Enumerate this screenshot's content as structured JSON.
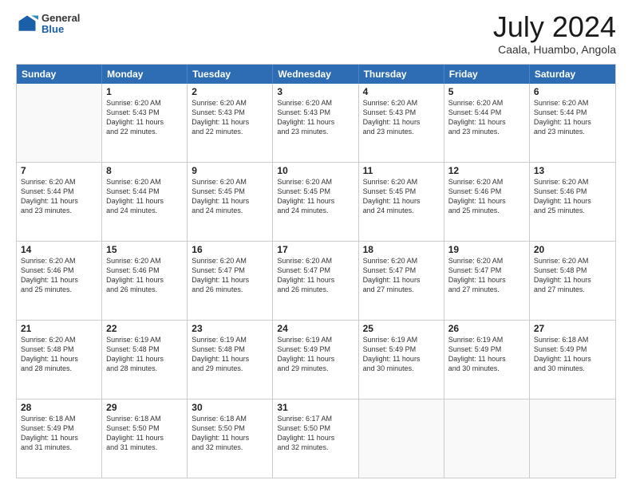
{
  "logo": {
    "general": "General",
    "blue": "Blue"
  },
  "title": {
    "month": "July 2024",
    "location": "Caala, Huambo, Angola"
  },
  "header_days": [
    "Sunday",
    "Monday",
    "Tuesday",
    "Wednesday",
    "Thursday",
    "Friday",
    "Saturday"
  ],
  "weeks": [
    [
      {
        "day": "",
        "lines": [],
        "empty": true
      },
      {
        "day": "1",
        "lines": [
          "Sunrise: 6:20 AM",
          "Sunset: 5:43 PM",
          "Daylight: 11 hours",
          "and 22 minutes."
        ]
      },
      {
        "day": "2",
        "lines": [
          "Sunrise: 6:20 AM",
          "Sunset: 5:43 PM",
          "Daylight: 11 hours",
          "and 22 minutes."
        ]
      },
      {
        "day": "3",
        "lines": [
          "Sunrise: 6:20 AM",
          "Sunset: 5:43 PM",
          "Daylight: 11 hours",
          "and 23 minutes."
        ]
      },
      {
        "day": "4",
        "lines": [
          "Sunrise: 6:20 AM",
          "Sunset: 5:43 PM",
          "Daylight: 11 hours",
          "and 23 minutes."
        ]
      },
      {
        "day": "5",
        "lines": [
          "Sunrise: 6:20 AM",
          "Sunset: 5:44 PM",
          "Daylight: 11 hours",
          "and 23 minutes."
        ]
      },
      {
        "day": "6",
        "lines": [
          "Sunrise: 6:20 AM",
          "Sunset: 5:44 PM",
          "Daylight: 11 hours",
          "and 23 minutes."
        ]
      }
    ],
    [
      {
        "day": "7",
        "lines": [
          "Sunrise: 6:20 AM",
          "Sunset: 5:44 PM",
          "Daylight: 11 hours",
          "and 23 minutes."
        ]
      },
      {
        "day": "8",
        "lines": [
          "Sunrise: 6:20 AM",
          "Sunset: 5:44 PM",
          "Daylight: 11 hours",
          "and 24 minutes."
        ]
      },
      {
        "day": "9",
        "lines": [
          "Sunrise: 6:20 AM",
          "Sunset: 5:45 PM",
          "Daylight: 11 hours",
          "and 24 minutes."
        ]
      },
      {
        "day": "10",
        "lines": [
          "Sunrise: 6:20 AM",
          "Sunset: 5:45 PM",
          "Daylight: 11 hours",
          "and 24 minutes."
        ]
      },
      {
        "day": "11",
        "lines": [
          "Sunrise: 6:20 AM",
          "Sunset: 5:45 PM",
          "Daylight: 11 hours",
          "and 24 minutes."
        ]
      },
      {
        "day": "12",
        "lines": [
          "Sunrise: 6:20 AM",
          "Sunset: 5:46 PM",
          "Daylight: 11 hours",
          "and 25 minutes."
        ]
      },
      {
        "day": "13",
        "lines": [
          "Sunrise: 6:20 AM",
          "Sunset: 5:46 PM",
          "Daylight: 11 hours",
          "and 25 minutes."
        ]
      }
    ],
    [
      {
        "day": "14",
        "lines": [
          "Sunrise: 6:20 AM",
          "Sunset: 5:46 PM",
          "Daylight: 11 hours",
          "and 25 minutes."
        ]
      },
      {
        "day": "15",
        "lines": [
          "Sunrise: 6:20 AM",
          "Sunset: 5:46 PM",
          "Daylight: 11 hours",
          "and 26 minutes."
        ]
      },
      {
        "day": "16",
        "lines": [
          "Sunrise: 6:20 AM",
          "Sunset: 5:47 PM",
          "Daylight: 11 hours",
          "and 26 minutes."
        ]
      },
      {
        "day": "17",
        "lines": [
          "Sunrise: 6:20 AM",
          "Sunset: 5:47 PM",
          "Daylight: 11 hours",
          "and 26 minutes."
        ]
      },
      {
        "day": "18",
        "lines": [
          "Sunrise: 6:20 AM",
          "Sunset: 5:47 PM",
          "Daylight: 11 hours",
          "and 27 minutes."
        ]
      },
      {
        "day": "19",
        "lines": [
          "Sunrise: 6:20 AM",
          "Sunset: 5:47 PM",
          "Daylight: 11 hours",
          "and 27 minutes."
        ]
      },
      {
        "day": "20",
        "lines": [
          "Sunrise: 6:20 AM",
          "Sunset: 5:48 PM",
          "Daylight: 11 hours",
          "and 27 minutes."
        ]
      }
    ],
    [
      {
        "day": "21",
        "lines": [
          "Sunrise: 6:20 AM",
          "Sunset: 5:48 PM",
          "Daylight: 11 hours",
          "and 28 minutes."
        ]
      },
      {
        "day": "22",
        "lines": [
          "Sunrise: 6:19 AM",
          "Sunset: 5:48 PM",
          "Daylight: 11 hours",
          "and 28 minutes."
        ]
      },
      {
        "day": "23",
        "lines": [
          "Sunrise: 6:19 AM",
          "Sunset: 5:48 PM",
          "Daylight: 11 hours",
          "and 29 minutes."
        ]
      },
      {
        "day": "24",
        "lines": [
          "Sunrise: 6:19 AM",
          "Sunset: 5:49 PM",
          "Daylight: 11 hours",
          "and 29 minutes."
        ]
      },
      {
        "day": "25",
        "lines": [
          "Sunrise: 6:19 AM",
          "Sunset: 5:49 PM",
          "Daylight: 11 hours",
          "and 30 minutes."
        ]
      },
      {
        "day": "26",
        "lines": [
          "Sunrise: 6:19 AM",
          "Sunset: 5:49 PM",
          "Daylight: 11 hours",
          "and 30 minutes."
        ]
      },
      {
        "day": "27",
        "lines": [
          "Sunrise: 6:18 AM",
          "Sunset: 5:49 PM",
          "Daylight: 11 hours",
          "and 30 minutes."
        ]
      }
    ],
    [
      {
        "day": "28",
        "lines": [
          "Sunrise: 6:18 AM",
          "Sunset: 5:49 PM",
          "Daylight: 11 hours",
          "and 31 minutes."
        ]
      },
      {
        "day": "29",
        "lines": [
          "Sunrise: 6:18 AM",
          "Sunset: 5:50 PM",
          "Daylight: 11 hours",
          "and 31 minutes."
        ]
      },
      {
        "day": "30",
        "lines": [
          "Sunrise: 6:18 AM",
          "Sunset: 5:50 PM",
          "Daylight: 11 hours",
          "and 32 minutes."
        ]
      },
      {
        "day": "31",
        "lines": [
          "Sunrise: 6:17 AM",
          "Sunset: 5:50 PM",
          "Daylight: 11 hours",
          "and 32 minutes."
        ]
      },
      {
        "day": "",
        "lines": [],
        "empty": true
      },
      {
        "day": "",
        "lines": [],
        "empty": true
      },
      {
        "day": "",
        "lines": [],
        "empty": true
      }
    ]
  ]
}
